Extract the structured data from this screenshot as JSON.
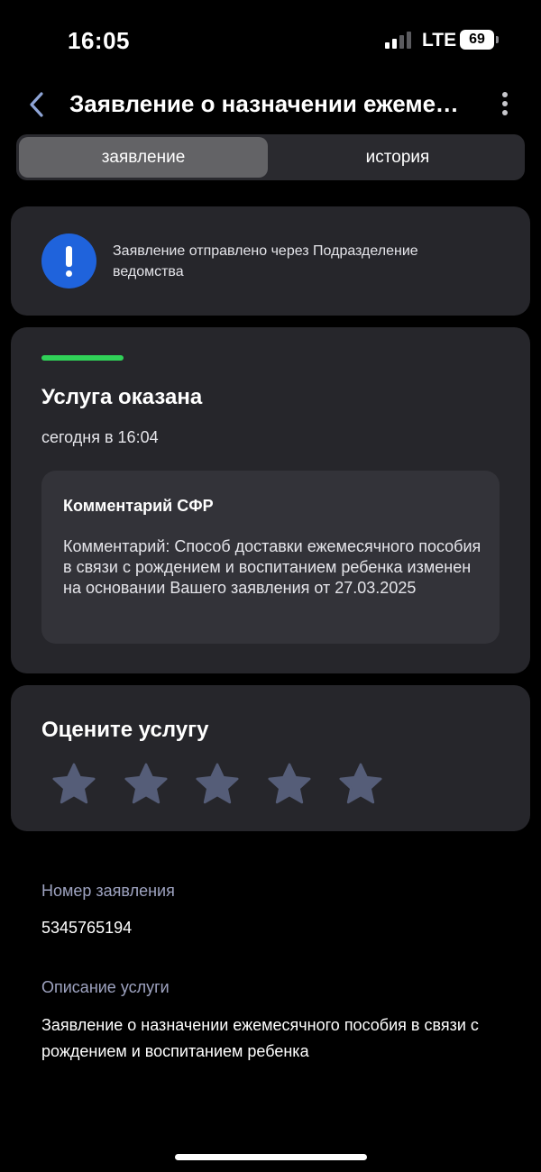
{
  "status_bar": {
    "time": "16:05",
    "network": "LTE",
    "battery": "69"
  },
  "header": {
    "title": "Заявление о назначении ежемесячного пособия в связи с рождением и воспитанием ребенка",
    "back_icon": "chevron-left-icon",
    "menu_icon": "more-vertical-icon"
  },
  "tabs": [
    {
      "label": "заявление",
      "active": true
    },
    {
      "label": "история",
      "active": false
    }
  ],
  "notice": {
    "icon": "exclamation-icon",
    "text": "Заявление отправлено через Подразделение ведомства",
    "icon_color": "#1f63dc"
  },
  "status": {
    "title": "Услуга оказана",
    "time": "сегодня в 16:04",
    "progress": 1,
    "progress_color": "#30d158",
    "comment": {
      "title": "Комментарий СФР",
      "text": "Комментарий: Способ доставки ежемесячного пособия в связи с рождением и воспитанием ребенка изменен на основании Вашего заявления от 27.03.2025"
    }
  },
  "rating": {
    "title": "Оцените услугу",
    "max_stars": 5,
    "selected": 0,
    "star_icon": "star-icon",
    "star_color": "#555d78"
  },
  "details": [
    {
      "label": "Номер заявления",
      "value": "5345765194"
    },
    {
      "label": "Описание услуги",
      "value": "Заявление о назначении ежемесячного пособия в связи с рождением и воспитанием ребенка"
    }
  ]
}
